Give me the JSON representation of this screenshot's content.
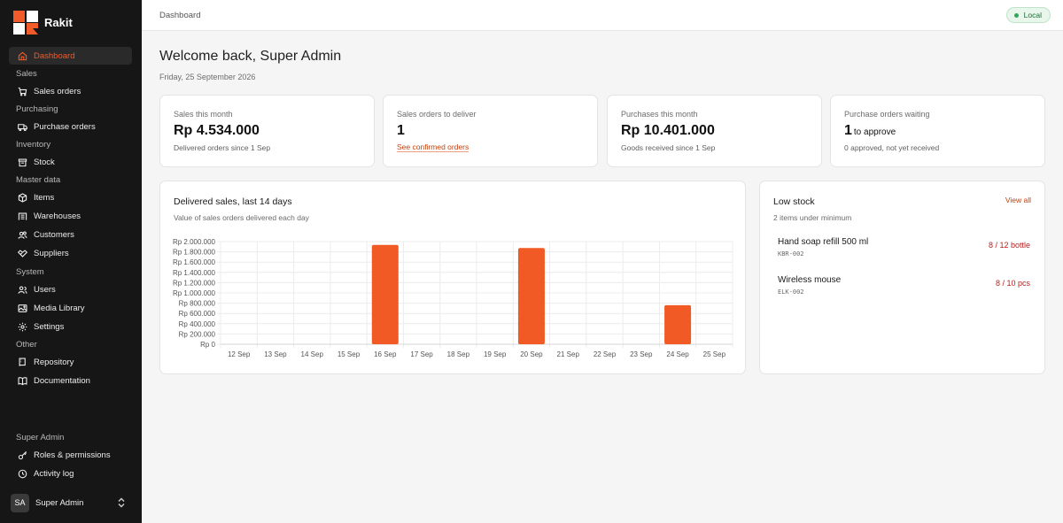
{
  "app": {
    "name": "Rakit",
    "brand_color": "#f15a29"
  },
  "sidebar": {
    "items": [
      {
        "kind": "item",
        "label": "Dashboard",
        "icon": "home-icon",
        "active": true
      },
      {
        "kind": "section",
        "label": "Sales"
      },
      {
        "kind": "item",
        "label": "Sales orders",
        "icon": "cart-icon"
      },
      {
        "kind": "section",
        "label": "Purchasing"
      },
      {
        "kind": "item",
        "label": "Purchase orders",
        "icon": "truck-icon"
      },
      {
        "kind": "section",
        "label": "Inventory"
      },
      {
        "kind": "item",
        "label": "Stock",
        "icon": "box-icon"
      },
      {
        "kind": "section",
        "label": "Master data"
      },
      {
        "kind": "item",
        "label": "Items",
        "icon": "cube-icon"
      },
      {
        "kind": "item",
        "label": "Warehouses",
        "icon": "warehouse-icon"
      },
      {
        "kind": "item",
        "label": "Customers",
        "icon": "customers-icon"
      },
      {
        "kind": "item",
        "label": "Suppliers",
        "icon": "handshake-icon"
      },
      {
        "kind": "section",
        "label": "System"
      },
      {
        "kind": "item",
        "label": "Users",
        "icon": "users-icon"
      },
      {
        "kind": "item",
        "label": "Media Library",
        "icon": "image-icon"
      },
      {
        "kind": "item",
        "label": "Settings",
        "icon": "gear-icon"
      },
      {
        "kind": "section",
        "label": "Other"
      },
      {
        "kind": "item",
        "label": "Repository",
        "icon": "repository-icon"
      },
      {
        "kind": "item",
        "label": "Documentation",
        "icon": "book-icon"
      }
    ],
    "admin_section": "Super Admin",
    "admin_items": [
      {
        "label": "Roles & permissions",
        "icon": "key-icon"
      },
      {
        "label": "Activity log",
        "icon": "clock-icon"
      }
    ],
    "user": {
      "initials": "SA",
      "name": "Super Admin"
    }
  },
  "topbar": {
    "breadcrumb": "Dashboard",
    "environment": "Local"
  },
  "header": {
    "welcome": "Welcome back, Super Admin",
    "date": "Friday, 25 September 2026"
  },
  "stats": [
    {
      "label": "Sales this month",
      "value": "Rp 4.534.000",
      "sub": "Delivered orders since 1 Sep"
    },
    {
      "label": "Sales orders to deliver",
      "value": "1",
      "link": "See confirmed orders"
    },
    {
      "label": "Purchases this month",
      "value": "Rp 10.401.000",
      "sub": "Goods received since 1 Sep"
    },
    {
      "label": "Purchase orders waiting",
      "value": "1",
      "value_suffix": "to approve",
      "sub": "0 approved, not yet received"
    }
  ],
  "chart_card": {
    "title": "Delivered sales, last 14 days",
    "subtitle": "Value of sales orders delivered each day"
  },
  "chart_data": {
    "type": "bar",
    "title": "Delivered sales, last 14 days",
    "subtitle": "Value of sales orders delivered each day",
    "categories": [
      "12 Sep",
      "13 Sep",
      "14 Sep",
      "15 Sep",
      "16 Sep",
      "17 Sep",
      "18 Sep",
      "19 Sep",
      "20 Sep",
      "21 Sep",
      "22 Sep",
      "23 Sep",
      "24 Sep",
      "25 Sep"
    ],
    "values": [
      0,
      0,
      0,
      0,
      1935000,
      0,
      0,
      0,
      1875000,
      0,
      0,
      0,
      760000,
      0
    ],
    "ylim": [
      0,
      2000000
    ],
    "yticks": [
      0,
      200000,
      400000,
      600000,
      800000,
      1000000,
      1200000,
      1400000,
      1600000,
      1800000,
      2000000
    ],
    "ytick_labels": [
      "Rp 0",
      "Rp 200.000",
      "Rp 400.000",
      "Rp 600.000",
      "Rp 800.000",
      "Rp 1.000.000",
      "Rp 1.200.000",
      "Rp 1.400.000",
      "Rp 1.600.000",
      "Rp 1.800.000",
      "Rp 2.000.000"
    ],
    "bar_color": "#f15a24",
    "grid": true
  },
  "low_stock": {
    "title": "Low stock",
    "view_all": "View all",
    "subtitle": "2 items under minimum",
    "items": [
      {
        "name": "Hand soap refill 500 ml",
        "sku": "KBR-002",
        "qty": "8 / 12 bottle"
      },
      {
        "name": "Wireless mouse",
        "sku": "ELK-002",
        "qty": "8 / 10 pcs"
      }
    ]
  }
}
